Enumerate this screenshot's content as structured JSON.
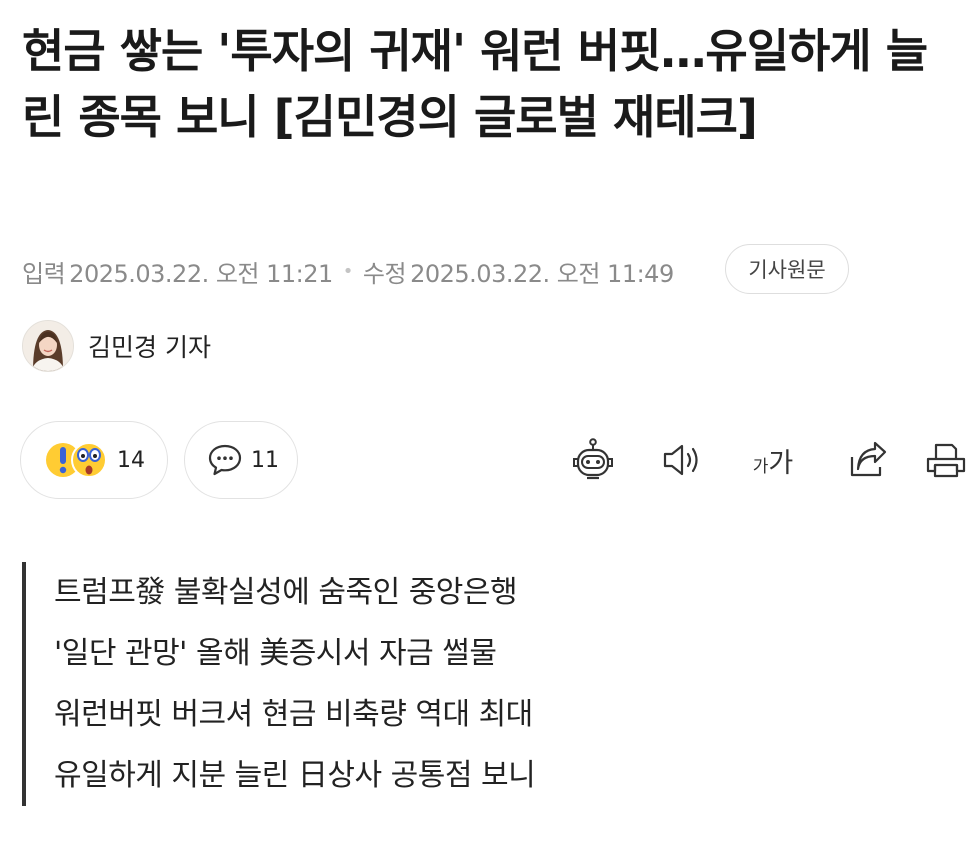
{
  "article": {
    "headline": "현금 쌓는 '투자의 귀재' 워런 버핏…유일하게 늘린 종목 보니 [김민경의 글로벌 재테크]",
    "published_label": "입력",
    "published": "2025.03.22. 오전 11:21",
    "modified_label": "수정",
    "modified": "2025.03.22. 오전 11:49",
    "original_button": "기사원문"
  },
  "reporter": {
    "name": "김민경 기자"
  },
  "engagement": {
    "reaction_count": "14",
    "comment_count": "11"
  },
  "toolbar": {
    "icons": [
      "ai-bot-icon",
      "speaker-icon",
      "font-size-icon",
      "share-icon",
      "print-icon"
    ],
    "font_size_small": "가",
    "font_size_large": "가"
  },
  "summary": [
    "트럼프發 불확실성에 숨죽인 중앙은행",
    "'일단 관망' 올해 美증시서 자금 썰물",
    "워런버핏 버크셔 현금 비축량 역대 최대",
    "유일하게 지분 늘린 日상사 공통점 보니"
  ]
}
